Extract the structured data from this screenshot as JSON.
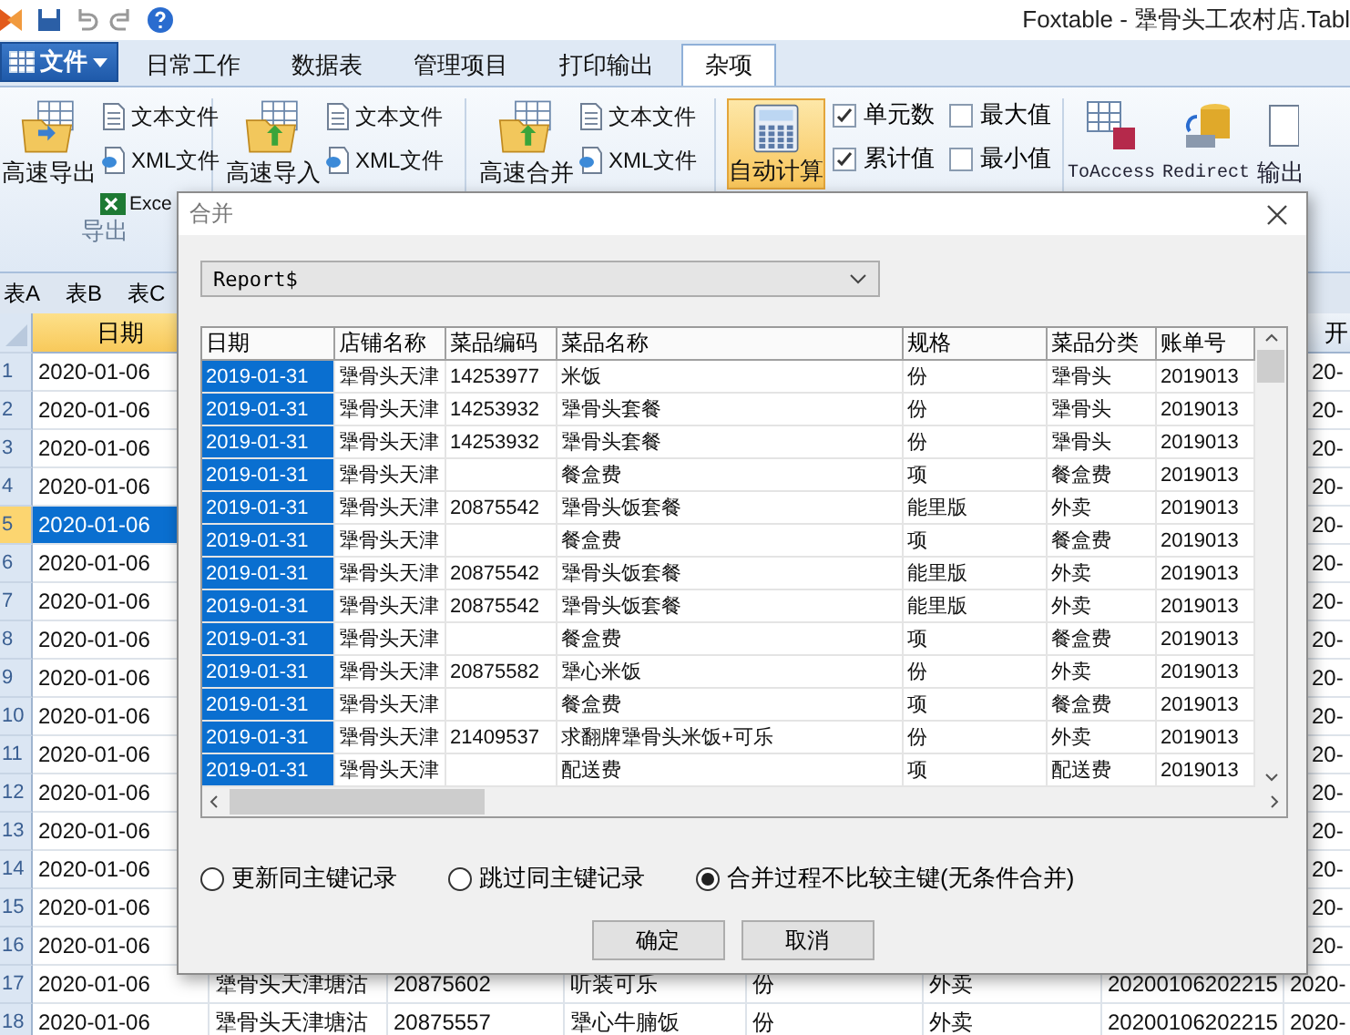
{
  "window": {
    "title": "Foxtable - 犟骨头工农村店.Tabl"
  },
  "menu_tabs": [
    {
      "label": "文件",
      "kind": "file"
    },
    {
      "label": "日常工作",
      "kind": "tab",
      "selected": false
    },
    {
      "label": "数据表",
      "kind": "tab",
      "selected": false
    },
    {
      "label": "管理项目",
      "kind": "tab",
      "selected": false
    },
    {
      "label": "打印输出",
      "kind": "tab",
      "selected": false
    },
    {
      "label": "杂项",
      "kind": "tab",
      "selected": true
    }
  ],
  "ribbon": {
    "groups": [
      {
        "large": "高速导出",
        "items": [
          "文本文件",
          "XML文件",
          "Exce"
        ],
        "label": "导出"
      },
      {
        "large": "高速导入",
        "items": [
          "文本文件",
          "XML文件"
        ]
      },
      {
        "large": "高速合并",
        "items": [
          "文本文件",
          "XML文件"
        ]
      }
    ],
    "auto_calc": {
      "label": "自动计算",
      "selected": true
    },
    "checkboxes": [
      {
        "label": "单元数",
        "checked": true
      },
      {
        "label": "最大值",
        "checked": false
      },
      {
        "label": "累计值",
        "checked": true
      },
      {
        "label": "最小值",
        "checked": false
      }
    ],
    "tools": [
      "ToAccess",
      "Redirect",
      "输出"
    ]
  },
  "sheet_tabs": [
    "表A",
    "表B",
    "表C"
  ],
  "grid": {
    "date_header": "日期",
    "tail_header": "开",
    "rows": [
      {
        "number": "1",
        "date": "2020-01-06",
        "selected": false,
        "tail": "20-"
      },
      {
        "number": "2",
        "date": "2020-01-06",
        "selected": false,
        "tail": "20-"
      },
      {
        "number": "3",
        "date": "2020-01-06",
        "selected": false,
        "tail": "20-"
      },
      {
        "number": "4",
        "date": "2020-01-06",
        "selected": false,
        "tail": "20-"
      },
      {
        "number": "5",
        "date": "2020-01-06",
        "selected": true,
        "tail": "20-"
      },
      {
        "number": "6",
        "date": "2020-01-06",
        "selected": false,
        "tail": "20-"
      },
      {
        "number": "7",
        "date": "2020-01-06",
        "selected": false,
        "tail": "20-"
      },
      {
        "number": "8",
        "date": "2020-01-06",
        "selected": false,
        "tail": "20-"
      },
      {
        "number": "9",
        "date": "2020-01-06",
        "selected": false,
        "tail": "20-"
      },
      {
        "number": "10",
        "date": "2020-01-06",
        "selected": false,
        "tail": "20-"
      },
      {
        "number": "11",
        "date": "2020-01-06",
        "selected": false,
        "tail": "20-"
      },
      {
        "number": "12",
        "date": "2020-01-06",
        "selected": false,
        "tail": "20-"
      },
      {
        "number": "13",
        "date": "2020-01-06",
        "selected": false,
        "tail": "20-"
      },
      {
        "number": "14",
        "date": "2020-01-06",
        "selected": false,
        "tail": "20-"
      },
      {
        "number": "15",
        "date": "2020-01-06",
        "selected": false,
        "tail": "20-"
      },
      {
        "number": "16",
        "date": "2020-01-06",
        "selected": false,
        "tail": "20-"
      },
      {
        "number": "17",
        "date": "2020-01-06",
        "selected": false,
        "cells": [
          "犟骨头天津塘沽",
          "20875602",
          "听装可乐",
          "份",
          "外卖",
          "20200106202215"
        ],
        "tail": "2020-"
      },
      {
        "number": "18",
        "date": "2020-01-06",
        "selected": false,
        "cells": [
          "犟骨头天津塘沽",
          "20875557",
          "犟心牛腩饭",
          "份",
          "外卖",
          "20200106202215"
        ],
        "tail": "2020-"
      }
    ]
  },
  "merge_dialog": {
    "title": "合并",
    "table_select": "Report$",
    "columns": [
      {
        "label": "日期",
        "selected": true
      },
      {
        "label": "店铺名称",
        "selected": false
      },
      {
        "label": "菜品编码",
        "selected": false
      },
      {
        "label": "菜品名称",
        "selected": false
      },
      {
        "label": "规格",
        "selected": false
      },
      {
        "label": "菜品分类",
        "selected": false
      },
      {
        "label": "账单号",
        "selected": false
      }
    ],
    "rows": [
      [
        "2019-01-31",
        "犟骨头天津",
        "14253977",
        "米饭",
        "份",
        "犟骨头",
        "2019013"
      ],
      [
        "2019-01-31",
        "犟骨头天津",
        "14253932",
        "犟骨头套餐",
        "份",
        "犟骨头",
        "2019013"
      ],
      [
        "2019-01-31",
        "犟骨头天津",
        "14253932",
        "犟骨头套餐",
        "份",
        "犟骨头",
        "2019013"
      ],
      [
        "2019-01-31",
        "犟骨头天津",
        null,
        "餐盒费",
        "项",
        "餐盒费",
        "2019013"
      ],
      [
        "2019-01-31",
        "犟骨头天津",
        "20875542",
        "犟骨头饭套餐",
        "能里版",
        "外卖",
        "2019013"
      ],
      [
        "2019-01-31",
        "犟骨头天津",
        null,
        "餐盒费",
        "项",
        "餐盒费",
        "2019013"
      ],
      [
        "2019-01-31",
        "犟骨头天津",
        "20875542",
        "犟骨头饭套餐",
        "能里版",
        "外卖",
        "2019013"
      ],
      [
        "2019-01-31",
        "犟骨头天津",
        "20875542",
        "犟骨头饭套餐",
        "能里版",
        "外卖",
        "2019013"
      ],
      [
        "2019-01-31",
        "犟骨头天津",
        null,
        "餐盒费",
        "项",
        "餐盒费",
        "2019013"
      ],
      [
        "2019-01-31",
        "犟骨头天津",
        "20875582",
        "犟心米饭",
        "份",
        "外卖",
        "2019013"
      ],
      [
        "2019-01-31",
        "犟骨头天津",
        null,
        "餐盒费",
        "项",
        "餐盒费",
        "2019013"
      ],
      [
        "2019-01-31",
        "犟骨头天津",
        "21409537",
        "求翻牌犟骨头米饭+可乐",
        "份",
        "外卖",
        "2019013"
      ],
      [
        "2019-01-31",
        "犟骨头天津",
        null,
        "配送费",
        "项",
        "配送费",
        "2019013"
      ]
    ],
    "options": [
      {
        "label": "更新同主键记录",
        "selected": false
      },
      {
        "label": "跳过同主键记录",
        "selected": false
      },
      {
        "label": "合并过程不比较主键(无条件合并)",
        "selected": true
      }
    ],
    "buttons": [
      "确定",
      "取消"
    ]
  }
}
